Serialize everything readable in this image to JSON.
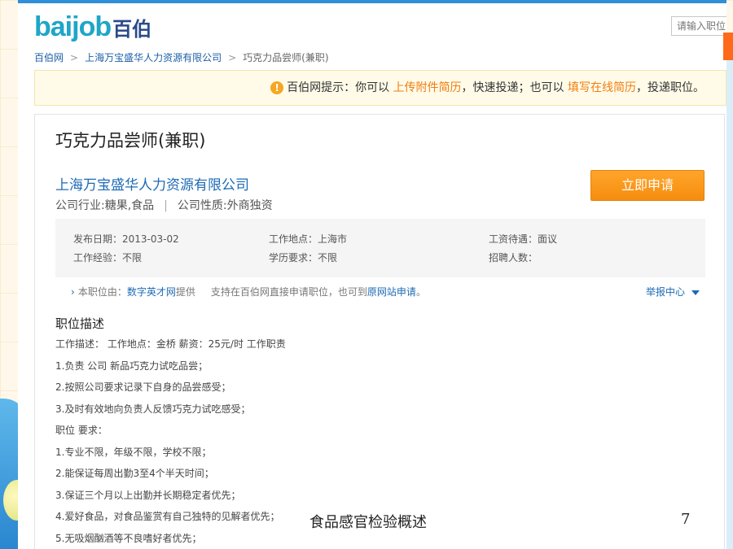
{
  "header": {
    "logo_latin": "baijob",
    "logo_cn": "百伯",
    "search_placeholder": "请输入职位"
  },
  "breadcrumb": {
    "home": "百伯网",
    "company": "上海万宝盛华人力资源有限公司",
    "current": "巧克力品尝师(兼职)"
  },
  "notice": {
    "prefix": "百伯网提示：你可以",
    "link1": "上传附件简历",
    "middle": "，快速投递；也可以",
    "link2": "填写在线简历",
    "suffix": "，投递职位。"
  },
  "job": {
    "title": "巧克力品尝师(兼职)",
    "company": "上海万宝盛华人力资源有限公司",
    "industry": "公司行业:糖果,食品",
    "nature": "公司性质:外商独资",
    "apply_label": "立即申请"
  },
  "info": {
    "publish_date": "发布日期：2013-03-02",
    "location": "工作地点：上海市",
    "salary": "工资待遇：面议",
    "experience": "工作经验：不限",
    "education": "学历要求：不限",
    "headcount": "招聘人数："
  },
  "source": {
    "prefix": "本职位由：",
    "provider": "数字英才网",
    "middle": "提供     支持在百伯网直接申请职位，也可到",
    "original": "原网站申请",
    "suffix": "。",
    "report": "举报中心"
  },
  "description": {
    "heading": "职位描述",
    "lines": [
      "工作描述：  工作地点：金桥  薪资：25元/时  工作职责",
      "1.负责 公司 新品巧克力试吃品尝；",
      "2.按照公司要求记录下自身的品尝感受；",
      "3.及时有效地向负责人反馈巧克力试吃感受；",
      "职位 要求：",
      "1.专业不限，年级不限，学校不限；",
      "2.能保证每周出勤3至4个半天时间；",
      "3.保证三个月以上出勤并长期稳定者优先；",
      "4.爱好食品，对食品鉴赏有自己独特的见解者优先；",
      "5.无吸烟酗酒等不良嗜好者优先；"
    ]
  },
  "slide": {
    "footer": "食品感官检验概述",
    "page_number": "7"
  }
}
